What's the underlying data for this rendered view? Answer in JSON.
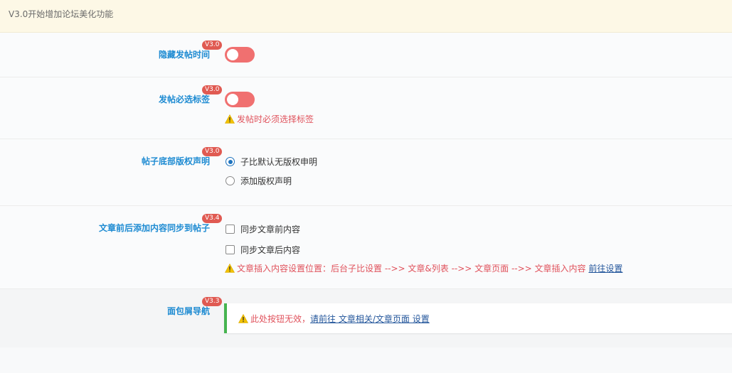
{
  "notice": {
    "text": "V3.0开始增加论坛美化功能"
  },
  "settings": {
    "hide_post_time": {
      "label": "隐藏发帖时间",
      "badge": "V3.0",
      "enabled": false
    },
    "require_tag": {
      "label": "发帖必选标签",
      "badge": "V3.0",
      "enabled": false,
      "warning": "发帖时必须选择标签"
    },
    "copyright": {
      "label": "帖子底部版权声明",
      "badge": "V3.0",
      "options": [
        "子比默认无版权申明",
        "添加版权声明"
      ],
      "selected": "子比默认无版权申明"
    },
    "article_sync": {
      "label": "文章前后添加内容同步到帖子",
      "badge": "V3.4",
      "options": [
        "同步文章前内容",
        "同步文章后内容"
      ],
      "checked": [
        false,
        false
      ],
      "warning": "文章插入内容设置位置：后台子比设置 -->> 文章&列表 -->> 文章页面 -->> 文章插入内容",
      "warning_link": "前往设置"
    },
    "breadcrumb": {
      "label": "面包屑导航",
      "badge": "V3.3",
      "notice": "此处按钮无效，",
      "notice_link": "请前往 文章相关/文章页面 设置"
    }
  },
  "colors": {
    "accent_label": "#1e8bd2",
    "badge": "#e05a52",
    "toggle_off": "#f07070",
    "warning": "#e0525c",
    "success_bar": "#46b450"
  }
}
